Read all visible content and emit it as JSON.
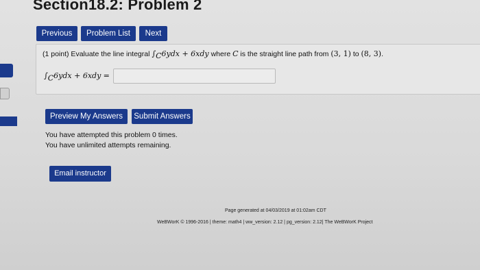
{
  "header": {
    "title": "Section18.2: Problem 2"
  },
  "nav": {
    "previous_label": "Previous",
    "problem_list_label": "Problem List",
    "next_label": "Next"
  },
  "problem": {
    "points_prefix": "(1 point) Evaluate the line integral ",
    "integral_sub": "C",
    "integrand": "6ydx + 6xdy",
    "where_text": " where ",
    "curve_var": "C",
    "path_text": " is the straight line path from ",
    "from_point": "(3, 1)",
    "to_text": " to ",
    "to_point": "(8, 3)",
    "end": "."
  },
  "answer": {
    "label_integrand": "6ydx + 6xdy",
    "label_sub": "C",
    "equals": "=",
    "value": ""
  },
  "actions": {
    "preview_label": "Preview My Answers",
    "submit_label": "Submit Answers"
  },
  "attempts": {
    "line1": "You have attempted this problem 0 times.",
    "line2": "You have unlimited attempts remaining."
  },
  "email": {
    "label": "Email instructor"
  },
  "footer": {
    "generated": "Page generated at 04/03/2019 at 01:02am CDT",
    "version": "WeBWorK © 1996-2016 | theme: math4 | ww_version: 2.12 | pg_version: 2.12| The WeBWorK Project"
  },
  "colors": {
    "button_bg": "#1b3a8c",
    "button_text": "#ffffff"
  }
}
